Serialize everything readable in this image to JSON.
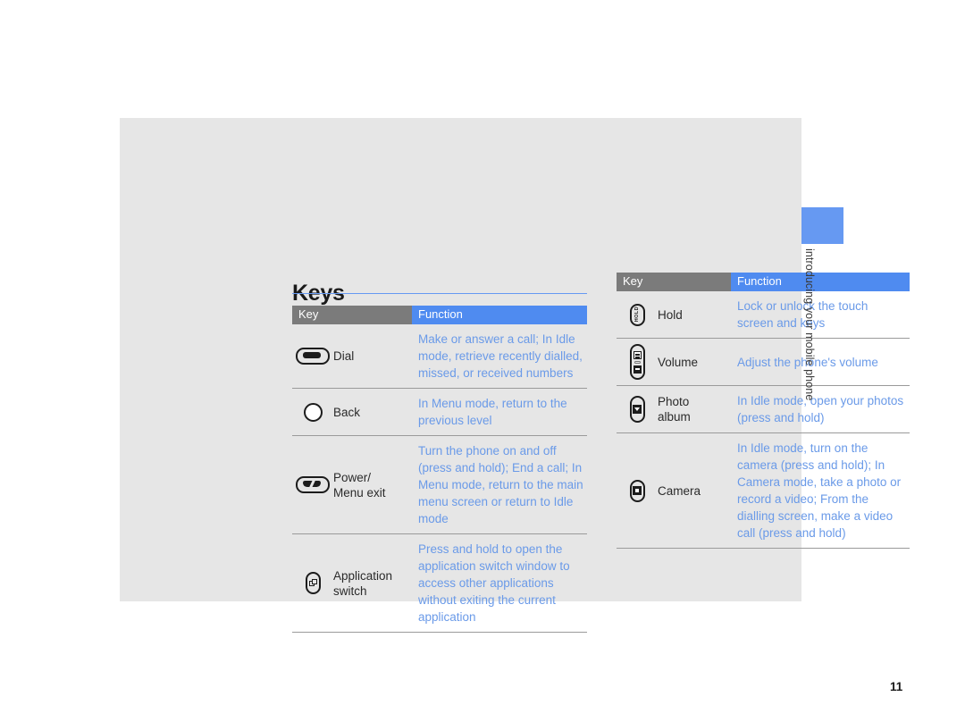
{
  "page": {
    "section_title": "Keys",
    "page_number": "11",
    "side_tab_label": "introducing your mobile phone",
    "accent_blue": "#4f8bf0",
    "body_blue": "#6a9ae8",
    "header_gray": "#7b7b7b",
    "sheet_bg": "#e6e6e6"
  },
  "table_left": {
    "header": {
      "key": "Key",
      "function": "Function"
    },
    "rows": [
      {
        "icon": "dial-key-icon",
        "key": "Dial",
        "function": "Make or answer a call; In Idle mode, retrieve recently dialled, missed, or received numbers"
      },
      {
        "icon": "back-key-icon",
        "key": "Back",
        "function": "In Menu mode, return to the previous level"
      },
      {
        "icon": "power-key-icon",
        "key": "Power/ Menu exit",
        "key_line1": "Power/",
        "key_line2": "Menu exit",
        "function": "Turn the phone on and off (press and hold); End a call; In Menu mode, return to the main menu screen or return to Idle mode"
      },
      {
        "icon": "application-switch-key-icon",
        "key": "Application switch",
        "key_line1": "Application",
        "key_line2": "switch",
        "function": "Press and hold to open the application switch window to access other applications without exiting the current application"
      }
    ]
  },
  "table_right": {
    "header": {
      "key": "Key",
      "function": "Function"
    },
    "rows": [
      {
        "icon": "hold-key-icon",
        "key": "Hold",
        "function": "Lock or unlock the touch screen and keys"
      },
      {
        "icon": "volume-key-icon",
        "key": "Volume",
        "function": "Adjust the phone's volume"
      },
      {
        "icon": "photo-album-key-icon",
        "key": "Photo album",
        "key_line1": "Photo",
        "key_line2": "album",
        "function": "In Idle mode, open your photos (press and hold)"
      },
      {
        "icon": "camera-key-icon",
        "key": "Camera",
        "function": "In Idle mode, turn on the camera (press and hold); In Camera mode, take a photo or record a video; From the dialling screen, make a video call (press and hold)"
      }
    ]
  }
}
